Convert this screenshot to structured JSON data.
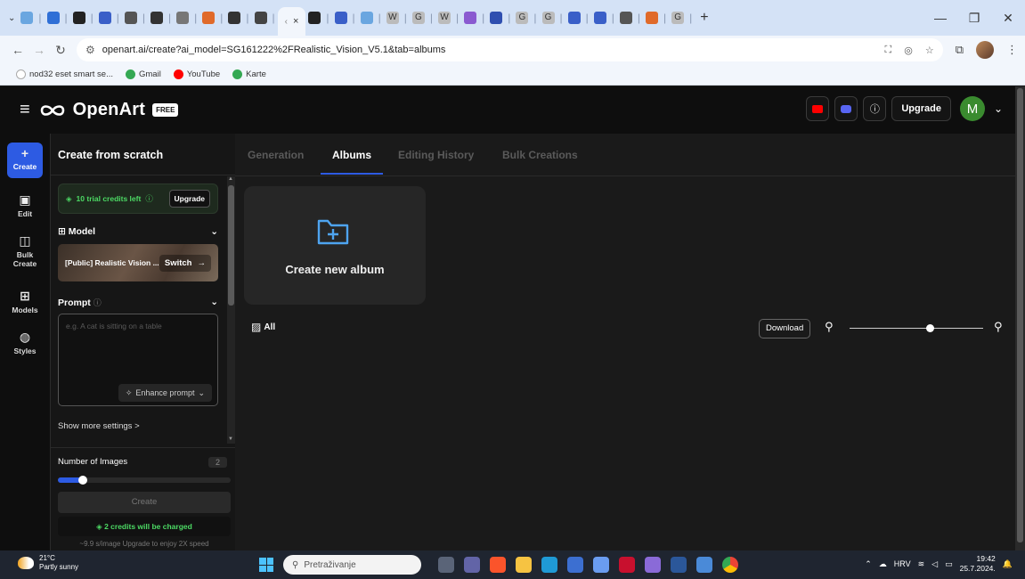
{
  "browser": {
    "active_tab_close": "×",
    "new_tab": "+",
    "url": "openart.ai/create?ai_model=SG161222%2FRealistic_Vision_V5.1&tab=albums",
    "mini_tabs": [
      {
        "label": "",
        "color": "#6aa6e0"
      },
      {
        "label": "",
        "color": "#2f6fd6"
      },
      {
        "label": "",
        "color": "#222222"
      },
      {
        "label": "",
        "color": "#3a5fc8"
      },
      {
        "label": "",
        "color": "#555555"
      },
      {
        "label": "",
        "color": "#333333"
      },
      {
        "label": "",
        "color": "#777777"
      },
      {
        "label": "",
        "color": "#e06a2a"
      },
      {
        "label": "",
        "color": "#333333"
      },
      {
        "label": "",
        "color": "#444444"
      }
    ],
    "mini_tabs_right": [
      {
        "label": "",
        "color": "#222222"
      },
      {
        "label": "",
        "color": "#3a5fc8"
      },
      {
        "label": "",
        "color": "#6aa6e0"
      },
      {
        "label": "W",
        "color": "#bbbbbb"
      },
      {
        "label": "G",
        "color": "#bbbbbb"
      },
      {
        "label": "W",
        "color": "#bbbbbb"
      },
      {
        "label": "",
        "color": "#8a5ad0"
      },
      {
        "label": "",
        "color": "#2f4fb0"
      },
      {
        "label": "G",
        "color": "#bbbbbb"
      },
      {
        "label": "G",
        "color": "#bbbbbb"
      },
      {
        "label": "",
        "color": "#3a5fc8"
      },
      {
        "label": "",
        "color": "#3a5fc8"
      },
      {
        "label": "",
        "color": "#555555"
      },
      {
        "label": "",
        "color": "#e06a2a"
      },
      {
        "label": "G",
        "color": "#bbbbbb"
      }
    ]
  },
  "bookmarks": [
    {
      "label": "nod32 eset smart se...",
      "color": "#ffffff"
    },
    {
      "label": "Gmail",
      "color": "#34a853"
    },
    {
      "label": "YouTube",
      "color": "#ff0000"
    },
    {
      "label": "Karte",
      "color": "#34a853"
    }
  ],
  "header": {
    "brand": "OpenArt",
    "badge": "FREE",
    "upgrade": "Upgrade",
    "avatar_letter": "M"
  },
  "rail": {
    "create": "Create",
    "edit": "Edit",
    "bulk_create_1": "Bulk",
    "bulk_create_2": "Create",
    "models": "Models",
    "styles": "Styles"
  },
  "panel": {
    "title": "Create from scratch",
    "credits": "10 trial credits left",
    "credits_upgrade": "Upgrade",
    "model_label": "Model",
    "model_name": "[Public] Realistic Vision ...",
    "switch": "Switch",
    "prompt_label": "Prompt",
    "prompt_placeholder": "e.g. A cat is sitting on a table",
    "enhance": "Enhance prompt",
    "show_more": "Show more settings >",
    "num_images_label": "Number of Images",
    "num_images_value": "2",
    "num_images_fraction": 0.12,
    "create": "Create",
    "charge_note": "2 credits will be charged",
    "speed_note": "~9.9 s/image Upgrade to enjoy 2X speed"
  },
  "main": {
    "tabs": [
      "Generation",
      "Albums",
      "Editing History",
      "Bulk Creations"
    ],
    "active_tab": 1,
    "new_album": "Create new album",
    "all_filter": "All",
    "download": "Download",
    "zoom_fraction": 0.6
  },
  "taskbar": {
    "temp": "21°C",
    "weather": "Partly sunny",
    "search": "Pretraživanje",
    "lang": "HRV",
    "time": "19:42",
    "date": "25.7.2024."
  },
  "colors": {
    "accent": "#2d5be3",
    "credit_green": "#4cd964"
  }
}
